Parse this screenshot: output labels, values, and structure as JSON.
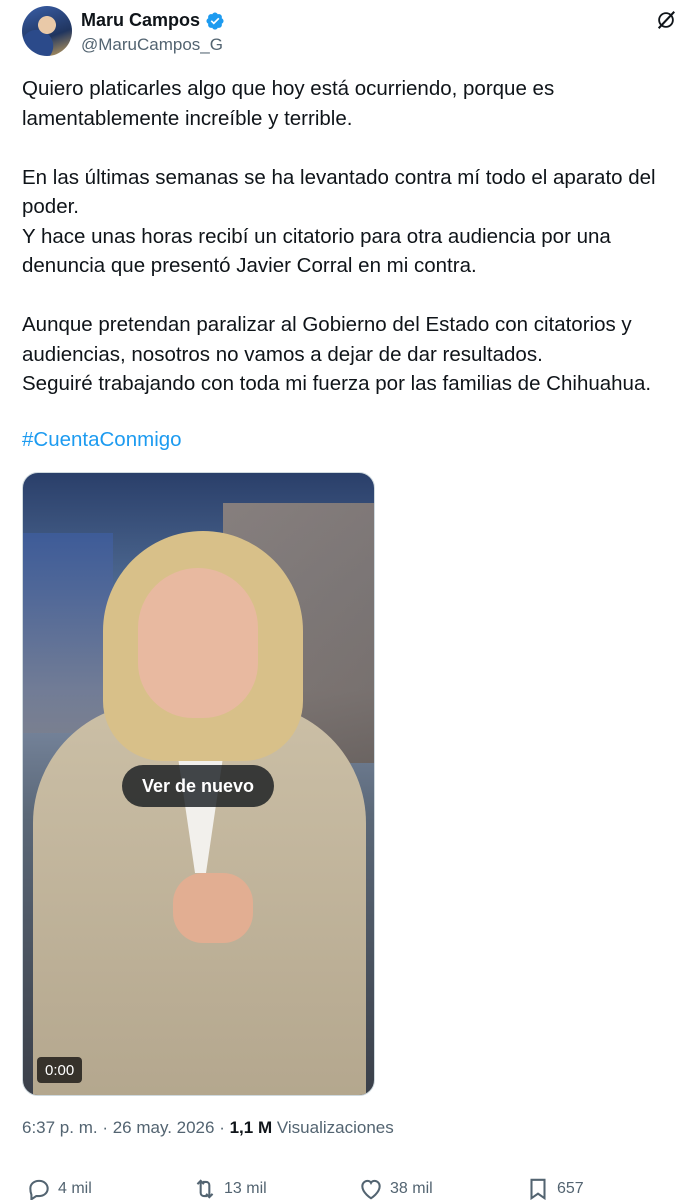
{
  "author": {
    "display_name": "Maru Campos",
    "handle": "@MaruCampos_G",
    "verified_icon": "verified-badge-icon",
    "accent": "#1d9bf0"
  },
  "post": {
    "paragraphs": [
      [
        "Quiero platicarles algo que hoy está ocurriendo, porque es",
        "lamentablemente increíble y terrible."
      ],
      [
        "En las últimas semanas se ha levantado contra mí todo el aparato del",
        "poder.",
        "Y hace unas horas recibí un citatorio para otra audiencia por una",
        "denuncia que presentó Javier Corral en mi contra."
      ],
      [
        "Aunque pretendan paralizar al Gobierno del Estado con citatorios y",
        "audiencias, nosotros no vamos a dejar de dar resultados.",
        "Seguiré trabajando con toda mi fuerza por las familias de Chihuahua."
      ]
    ],
    "hashtag": "#CuentaConmigo",
    "media": {
      "replay_label": "Ver de nuevo",
      "time": "0:00"
    },
    "meta": {
      "time": "6:37 p. m.",
      "separator": " · ",
      "date": "26 may. 2026",
      "views_count": "1,1 M",
      "views_label": "Visualizaciones"
    }
  },
  "actions": {
    "replies": "4 mil",
    "reposts": "13 mil",
    "likes": "38 mil",
    "bookmarks": "657"
  }
}
